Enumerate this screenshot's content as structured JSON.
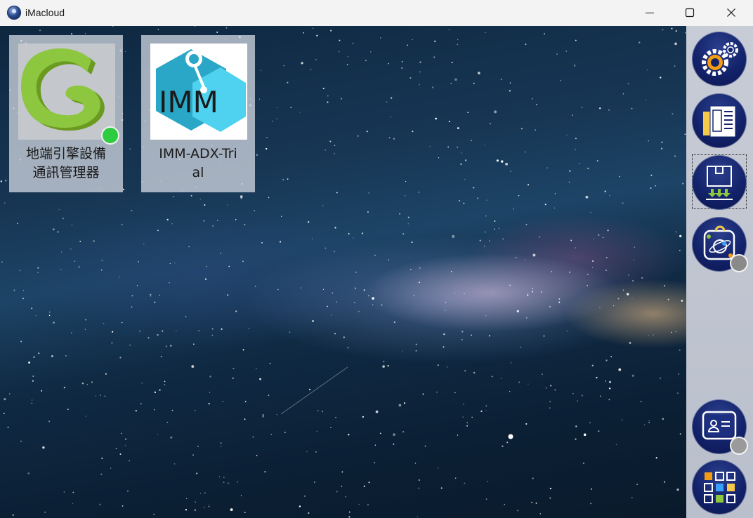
{
  "window": {
    "title": "iMacloud",
    "controls": {
      "minimize": "minimize-icon",
      "maximize": "maximize-icon",
      "close": "close-icon"
    }
  },
  "desktop": {
    "background": "milky-way-starfield",
    "apps": [
      {
        "label": "地端引擎設備通訊管理器",
        "icon": "green-c-logo-icon",
        "status_color": "#2ecc40"
      },
      {
        "label": "IMM-ADX-Trial",
        "icon_text": "IMM",
        "icon": "imm-hexagon-icon"
      }
    ]
  },
  "sidebar": {
    "items": [
      {
        "name": "settings",
        "icon": "gears-icon"
      },
      {
        "name": "files",
        "icon": "folder-document-icon"
      },
      {
        "name": "install",
        "icon": "package-download-icon"
      },
      {
        "name": "space",
        "icon": "planet-shop-icon"
      },
      {
        "name": "account",
        "icon": "id-card-icon"
      },
      {
        "name": "apps",
        "icon": "app-grid-icon"
      }
    ],
    "status_color": "#8a8a8a"
  }
}
